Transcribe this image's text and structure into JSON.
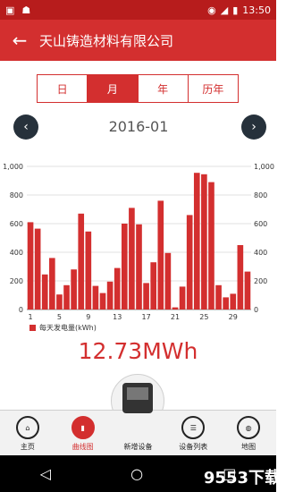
{
  "status": {
    "time": "13:50"
  },
  "appbar": {
    "back": "←",
    "title": "天山铸造材料有限公司"
  },
  "tabs": [
    {
      "label": "日",
      "active": false
    },
    {
      "label": "月",
      "active": true
    },
    {
      "label": "年",
      "active": false
    },
    {
      "label": "历年",
      "active": false
    }
  ],
  "period": {
    "label": "2016-01",
    "prev": "‹",
    "next": "›"
  },
  "chart_data": {
    "type": "bar",
    "xlabel": "",
    "ylabel": "",
    "ylim": [
      0,
      1000
    ],
    "yticks": [
      0,
      200,
      400,
      600,
      800,
      1000
    ],
    "ytick_labels": [
      "0",
      "200",
      "400",
      "600",
      "800",
      "1,000"
    ],
    "xticks": [
      1,
      5,
      9,
      13,
      17,
      21,
      25,
      29
    ],
    "categories": [
      1,
      2,
      3,
      4,
      5,
      6,
      7,
      8,
      9,
      10,
      11,
      12,
      13,
      14,
      15,
      16,
      17,
      18,
      19,
      20,
      21,
      22,
      23,
      24,
      25,
      26,
      27,
      28,
      29,
      30,
      31
    ],
    "series": [
      {
        "name": "每天发电量(kWh)",
        "values": [
          610,
          565,
          245,
          360,
          105,
          170,
          280,
          670,
          545,
          165,
          115,
          195,
          290,
          600,
          710,
          595,
          185,
          330,
          760,
          395,
          15,
          160,
          660,
          955,
          945,
          890,
          170,
          85,
          110,
          450,
          265
        ]
      }
    ],
    "color": "#d32f2f"
  },
  "legend": {
    "label": "每天发电量(kWh)"
  },
  "total": {
    "value": "12.73MWh"
  },
  "bottomnav": [
    {
      "label": "主页",
      "icon": "home-icon",
      "active": false
    },
    {
      "label": "曲线图",
      "icon": "bar-chart-icon",
      "active": true
    },
    {
      "label": "新增设备",
      "icon": "add-device-icon",
      "active": false
    },
    {
      "label": "设备列表",
      "icon": "list-icon",
      "active": false
    },
    {
      "label": "地图",
      "icon": "globe-icon",
      "active": false
    }
  ],
  "watermark": "9553下载"
}
